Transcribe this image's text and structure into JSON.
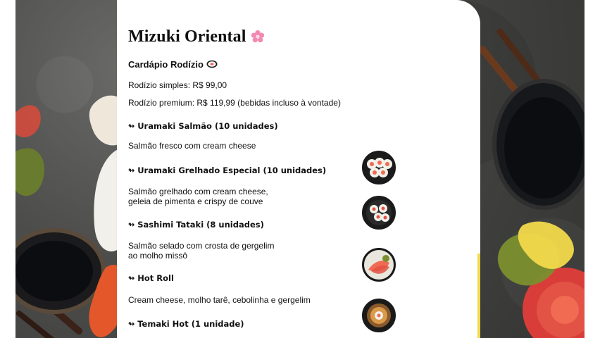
{
  "header": {
    "title": "Mizuki Oriental",
    "subtitle": "Cardápio Rodízio"
  },
  "prices": {
    "simple": "Rodízio simples: R$ 99,00",
    "premium": "Rodízio premium: R$ 119,99 (bebidas incluso à vontade)"
  },
  "menu_items": [
    {
      "title": "Uramaki Salmão (10 unidades)",
      "description": "Salmão fresco com cream cheese"
    },
    {
      "title": "Uramaki Grelhado Especial (10 unidades)",
      "description": "Salmão grelhado com cream cheese,\ngeleia de pimenta e crispy de couve"
    },
    {
      "title": "Sashimi Tataki (8 unidades)",
      "description": "Salmão selado com crosta de gergelim\nao molho missô"
    },
    {
      "title": "Hot Roll",
      "description": "Cream cheese, molho tarê, cebolinha e gergelim"
    },
    {
      "title": "Temaki Hot (1 unidade)"
    }
  ],
  "icons": {
    "flower": "cherry-blossom-icon",
    "roll": "sushi-roll-icon",
    "item_arrow": "arrow-icon"
  },
  "colors": {
    "card_bg": "#ffffff",
    "page_bg": "#4d4d4b",
    "text": "#111111",
    "accent_pink": "#f28ab2",
    "accent_yellow": "#f2d94b"
  }
}
